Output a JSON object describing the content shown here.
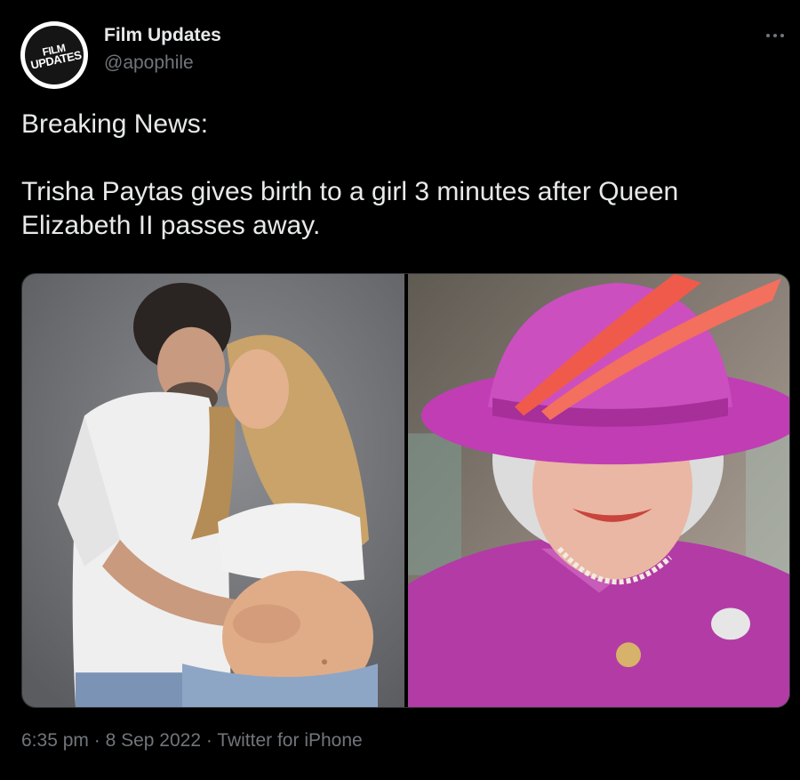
{
  "tweet": {
    "author": {
      "display_name": "Film Updates",
      "handle": "@apophile",
      "avatar_text_line1": "FILM",
      "avatar_text_line2": "UPDATES"
    },
    "text_lines": [
      "Breaking News:",
      "",
      "Trisha Paytas gives birth to a girl 3 minutes after Queen",
      "Elizabeth II passes away."
    ],
    "media": [
      {
        "name": "couple-photo"
      },
      {
        "name": "queen-photo"
      }
    ],
    "meta": {
      "time": "6:35 pm",
      "separator1": " · ",
      "date": "8 Sep 2022",
      "separator2": " · ",
      "source": "Twitter for iPhone"
    }
  },
  "icons": {
    "more": "more-horizontal-icon"
  },
  "colors": {
    "background": "#000000",
    "text_primary": "#e7e9ea",
    "text_secondary": "#71767b",
    "hat_magenta": "#c03ab8",
    "feather_red": "#f05a4a"
  }
}
